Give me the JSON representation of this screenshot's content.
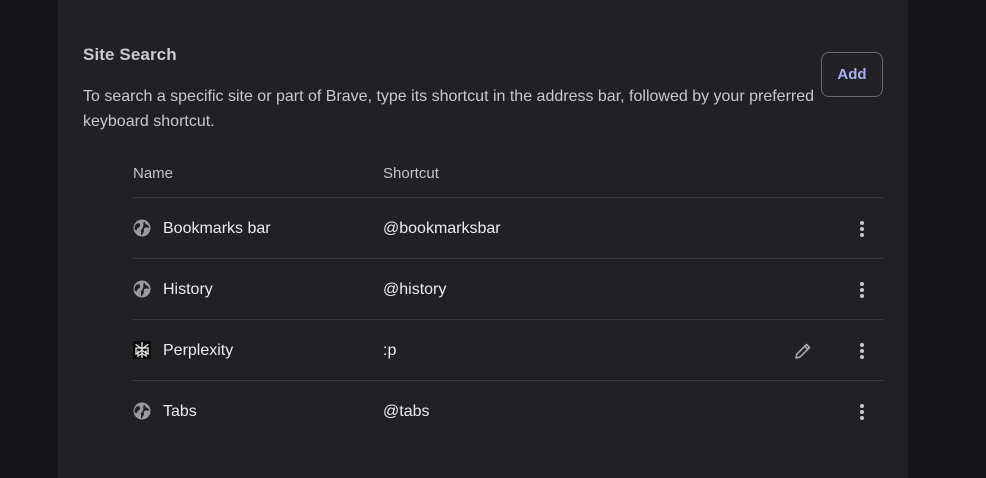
{
  "section": {
    "title": "Site Search",
    "description": "To search a specific site or part of Brave, type its shortcut in the address bar, followed by your preferred keyboard shortcut.",
    "add_label": "Add"
  },
  "table": {
    "headers": {
      "name": "Name",
      "shortcut": "Shortcut"
    },
    "rows": [
      {
        "name": "Bookmarks bar",
        "shortcut": "@bookmarksbar",
        "icon": "globe-icon",
        "editable": false
      },
      {
        "name": "History",
        "shortcut": "@history",
        "icon": "globe-icon",
        "editable": false
      },
      {
        "name": "Perplexity",
        "shortcut": ":p",
        "icon": "perplexity-favicon-icon",
        "editable": true
      },
      {
        "name": "Tabs",
        "shortcut": "@tabs",
        "icon": "globe-icon",
        "editable": false
      }
    ]
  },
  "colors": {
    "background": "#161618",
    "card": "#212125",
    "accent": "#a9aef2",
    "divider": "#3a3a40",
    "icon": "#9a9aa0"
  }
}
